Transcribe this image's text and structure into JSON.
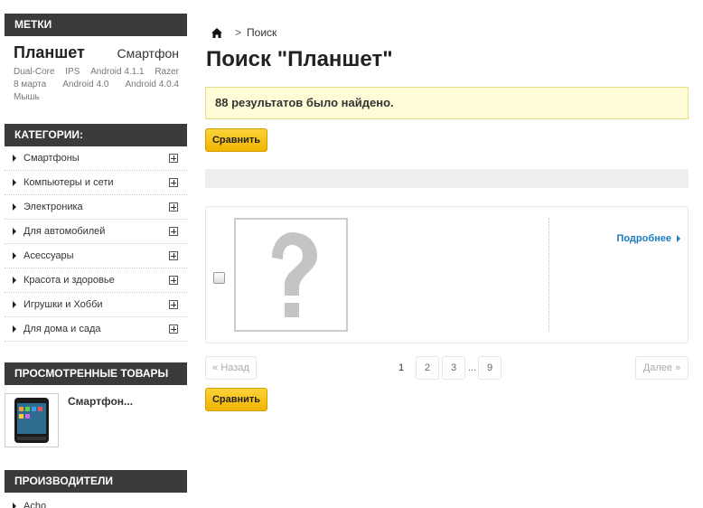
{
  "sidebar": {
    "tags": {
      "title": "МЕТКИ",
      "big": "Планшет",
      "medium": "Смартфон",
      "row2": [
        "Dual-Core",
        "IPS",
        "Android 4.1.1",
        "Razer"
      ],
      "row3": [
        "8 марта",
        "Android 4.0",
        "Android 4.0.4"
      ],
      "row4": [
        "Мышь"
      ]
    },
    "categories": {
      "title": "КАТЕГОРИИ:",
      "items": [
        {
          "label": "Смартфоны"
        },
        {
          "label": "Компьютеры и сети"
        },
        {
          "label": "Электроника"
        },
        {
          "label": "Для автомобилей"
        },
        {
          "label": "Асессуары"
        },
        {
          "label": "Красота и здоровье"
        },
        {
          "label": "Игрушки и Хобби"
        },
        {
          "label": "Для дома и сада"
        }
      ]
    },
    "viewed": {
      "title": "ПРОСМОТРЕННЫЕ ТОВАРЫ",
      "product_name": "Смартфон..."
    },
    "manufacturers": {
      "title": "ПРОИЗВОДИТЕЛИ",
      "items": [
        {
          "label": "Acho"
        }
      ]
    }
  },
  "main": {
    "breadcrumb": {
      "home_icon": "home-icon",
      "separator": ">",
      "current": "Поиск"
    },
    "title": "Поиск \"Планшет\"",
    "notice": "88 результатов было найдено.",
    "compare_label": "Сравнить",
    "product": {
      "more_label": "Подробнее"
    },
    "pager": {
      "prev": "« Назад",
      "next": "Далее »",
      "pages": [
        "1",
        "2",
        "3"
      ],
      "dots": "...",
      "last": "9"
    }
  },
  "colors": {
    "sidebar_header_bg": "#3a3a3a",
    "button_yellow": "#f8c213",
    "notice_bg": "#fffdd8",
    "link_blue": "#1b7dbf"
  }
}
